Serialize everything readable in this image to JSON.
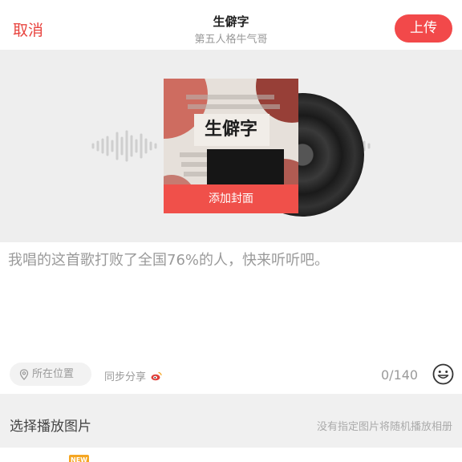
{
  "header": {
    "cancel_label": "取消",
    "title": "生僻字",
    "subtitle": "第五人格牛气哥",
    "upload_label": "上传"
  },
  "cover": {
    "add_cover_label": "添加封面",
    "art_title": "生僻字"
  },
  "composer": {
    "placeholder": "我唱的这首歌打败了全国76%的人，快来听听吧。",
    "location_label": "所在位置",
    "sync_share_label": "同步分享",
    "char_count": "0/140"
  },
  "playback_images": {
    "title": "选择播放图片",
    "hint": "没有指定图片将随机播放相册"
  },
  "badge": {
    "new_label": "NEW"
  },
  "icons": {
    "location": "location-pin-icon",
    "weibo": "weibo-icon",
    "emoji": "smiley-icon"
  },
  "colors": {
    "accent": "#f2494a",
    "cancel": "#e8433e",
    "muted_text": "#9a9a9a",
    "panel_bg": "#eeeeee"
  }
}
